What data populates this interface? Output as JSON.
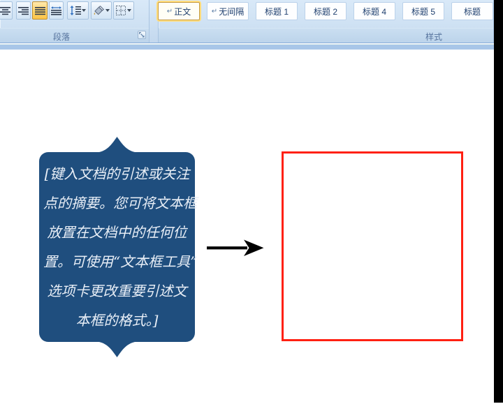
{
  "ribbon": {
    "paragraph_group": {
      "label": "段落",
      "buttons": [
        {
          "icon": "align-center-icon"
        },
        {
          "icon": "align-right-icon"
        },
        {
          "icon": "justify-icon",
          "active": true
        },
        {
          "icon": "distribute-icon"
        },
        {
          "icon": "line-spacing-icon",
          "has_dropdown": true
        },
        {
          "icon": "shading-icon",
          "has_dropdown": true
        },
        {
          "icon": "borders-icon",
          "has_dropdown": true
        }
      ],
      "dialog_launcher_icon": "dialog-launcher-icon"
    },
    "styles_group": {
      "label": "样式",
      "styles": [
        {
          "mark": "↵",
          "label": "正文",
          "selected": true
        },
        {
          "mark": "↵",
          "label": "无间隔"
        },
        {
          "mark": "",
          "label": "标题 1"
        },
        {
          "mark": "",
          "label": "标题 2"
        },
        {
          "mark": "",
          "label": "标题 4"
        },
        {
          "mark": "",
          "label": "标题 5"
        },
        {
          "mark": "",
          "label": "标题"
        }
      ]
    }
  },
  "document": {
    "pull_quote": {
      "lines": [
        "[键入文档的引述或关注",
        "点的摘要。您可将文本框",
        "放置在文档中的任何位",
        "置。可使用“文本框工具”",
        "选项卡更改重要引述文",
        "本框的格式。]"
      ],
      "fill_color": "#1f4e7e",
      "text_color": "#e9eff7"
    },
    "arrow": {
      "color": "#000000"
    },
    "red_box": {
      "border_color": "#ff2012"
    }
  }
}
